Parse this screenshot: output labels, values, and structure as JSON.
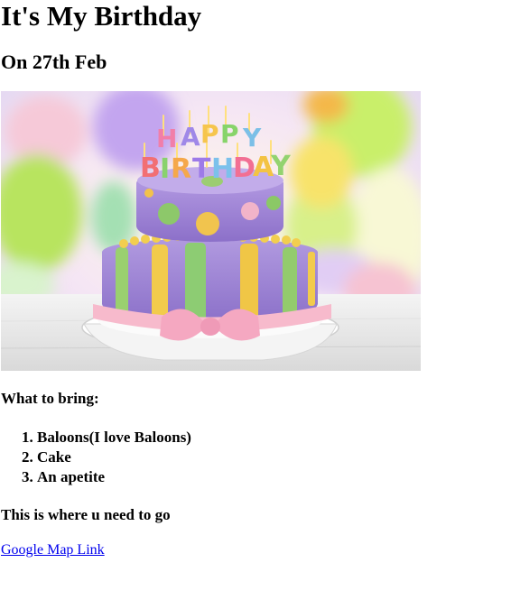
{
  "heading": "It's My Birthday",
  "subheading": "On 27th Feb",
  "image": {
    "alt": "cake-image",
    "candle_text": "HAPPY BIRTHDAY",
    "colors": {
      "purple": "#a58ad6",
      "green": "#8dc36a",
      "yellow": "#f3cf4d",
      "pink": "#f4b6c8",
      "background_green": "#c8ef6f",
      "background_purple": "#c2a6ef"
    }
  },
  "bring_title": "What to bring:",
  "bring_items": [
    "Baloons(I love Baloons)",
    "Cake",
    "An apetite"
  ],
  "directions_title": "This is where u need to go",
  "map_link": "Google Map Link"
}
